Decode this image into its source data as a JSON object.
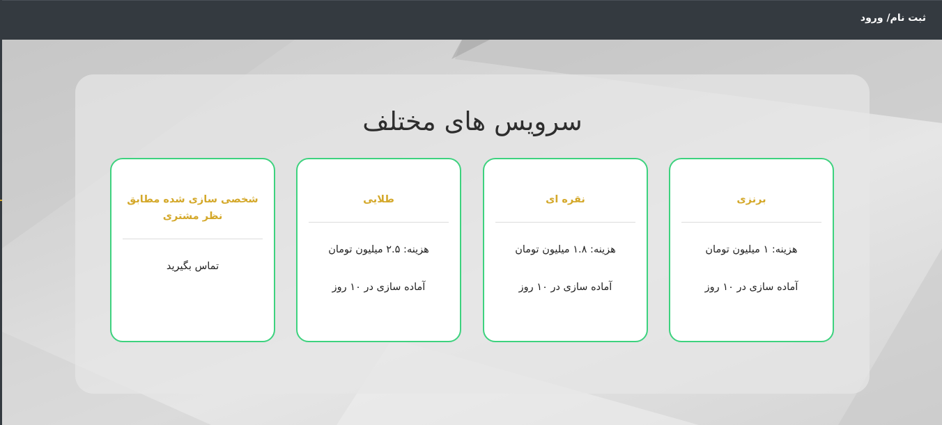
{
  "navbar": {
    "auth_link": "ثبت نام/ ورود"
  },
  "services": {
    "title": "سرویس های مختلف",
    "cards": [
      {
        "title": "برنزی",
        "price": "هزینه: ۱ میلیون تومان",
        "delivery": "آماده سازی در ۱۰ روز"
      },
      {
        "title": "نقره ای",
        "price": "هزینه: ۱.۸ میلیون تومان",
        "delivery": "آماده سازی در ۱۰ روز"
      },
      {
        "title": "طلایی",
        "price": "هزینه: ۲.۵ میلیون تومان",
        "delivery": "آماده سازی در ۱۰ روز"
      },
      {
        "title": "شخصی سازی شده مطابق نظر مشتری",
        "contact": "تماس بگیرید"
      }
    ]
  },
  "colors": {
    "navbar_bg": "#343a40",
    "card_border": "#3dd27e",
    "card_title": "#d4a82a"
  }
}
